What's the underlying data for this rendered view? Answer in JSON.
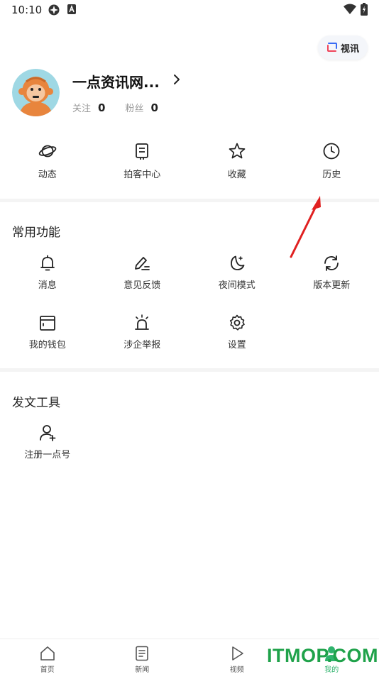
{
  "status_bar": {
    "time": "10:10"
  },
  "view_chip": {
    "label": "视讯"
  },
  "profile": {
    "name": "一点资讯网...",
    "follow_label": "关注",
    "follow_count": "0",
    "fans_label": "粉丝",
    "fans_count": "0"
  },
  "quick_actions": [
    {
      "label": "动态",
      "icon": "planet-icon"
    },
    {
      "label": "拍客中心",
      "icon": "camera-book-icon"
    },
    {
      "label": "收藏",
      "icon": "star-icon"
    },
    {
      "label": "历史",
      "icon": "clock-icon"
    }
  ],
  "common": {
    "title": "常用功能",
    "items": [
      {
        "label": "消息",
        "icon": "bell-icon"
      },
      {
        "label": "意见反馈",
        "icon": "pen-icon"
      },
      {
        "label": "夜间模式",
        "icon": "moon-icon"
      },
      {
        "label": "版本更新",
        "icon": "refresh-icon"
      },
      {
        "label": "我的钱包",
        "icon": "wallet-icon"
      },
      {
        "label": "涉企举报",
        "icon": "alarm-icon"
      },
      {
        "label": "设置",
        "icon": "gear-icon"
      }
    ]
  },
  "tools": {
    "title": "发文工具",
    "items": [
      {
        "label": "注册一点号",
        "icon": "add-user-icon"
      }
    ]
  },
  "bottom_nav": [
    {
      "label": "首页",
      "icon": "home-icon"
    },
    {
      "label": "新闻",
      "icon": "news-icon"
    },
    {
      "label": "视频",
      "icon": "play-icon"
    },
    {
      "label": "我的",
      "icon": "person-icon",
      "active": true
    }
  ],
  "watermark": "ITMOP.COM",
  "colors": {
    "accent_green": "#2fb36d",
    "annotation_red": "#e02020",
    "watermark_green": "#1fa24a"
  }
}
